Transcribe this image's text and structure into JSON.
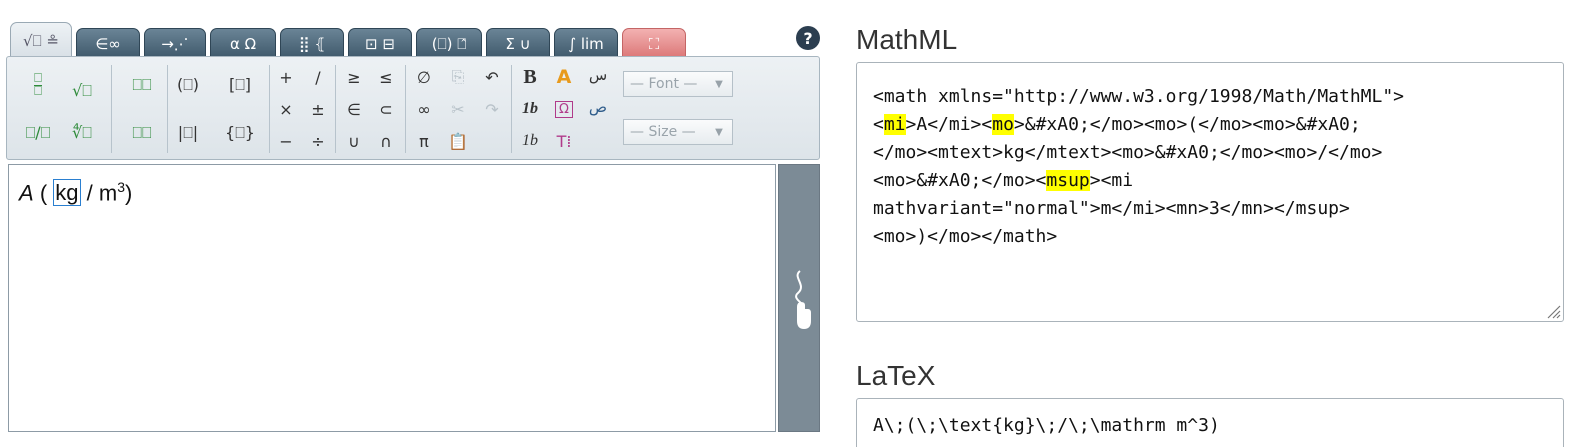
{
  "editor": {
    "tabs": [
      {
        "label": "√⎕ ≗"
      },
      {
        "label": "∈∞"
      },
      {
        "label": "→⋰"
      },
      {
        "label": "α Ω"
      },
      {
        "label": "⣿ ⦃"
      },
      {
        "label": "⊡ ⊟"
      },
      {
        "label": "(⎕) ⎕̂"
      },
      {
        "label": "Σ ∪"
      },
      {
        "label": "∫ lim"
      },
      {
        "label": "⛶"
      }
    ],
    "help_label": "?",
    "toolbar": {
      "fraction": "⎕/⎕",
      "slash_fraction": "⎕/⎕",
      "sqrt": "√⎕",
      "nth_root": "∜⎕",
      "superscript": "⎕⎕",
      "subscript": "⎕⎕",
      "parens": "(⎕)",
      "abs": "|⎕|",
      "brackets": "[⎕]",
      "braces": "{⎕}",
      "ops": [
        "+",
        "/",
        "×",
        "±",
        "−",
        "÷"
      ],
      "relations": [
        "≥",
        "≤",
        "∈",
        "⊂",
        "∪",
        "∩"
      ],
      "misc": [
        "∅",
        "∞",
        "π"
      ],
      "bold": "B",
      "italic_1": "1b",
      "italic_2": "1b",
      "font_placeholder": "— Font —",
      "size_placeholder": "— Size —"
    },
    "formula": {
      "var": "A",
      "open": "(",
      "text": "kg",
      "slash": "/",
      "unit": "m",
      "exp": "3",
      "close": ")"
    }
  },
  "mathml": {
    "label": "MathML",
    "lines": [
      [
        "<math xmlns=\"http://www.w3.org/1998/Math/MathML\">"
      ],
      [
        "<",
        "mi",
        ">A</mi><",
        "mo",
        ">&#xA0;</mo><mo>(</mo><mo>&#xA0;"
      ],
      [
        "</mo><mtext>kg</mtext><mo>&#xA0;</mo><mo>/</mo>"
      ],
      [
        "<mo>&#xA0;</mo><",
        "msup",
        "><mi"
      ],
      [
        "mathvariant=\"normal\">m</mi><mn>3</mn></msup>"
      ],
      [
        "<mo>)</mo></math>"
      ]
    ]
  },
  "latex": {
    "label": "LaTeX",
    "value": "A\\;(\\;\\text{kg}\\;/\\;\\mathrm m^3)"
  }
}
